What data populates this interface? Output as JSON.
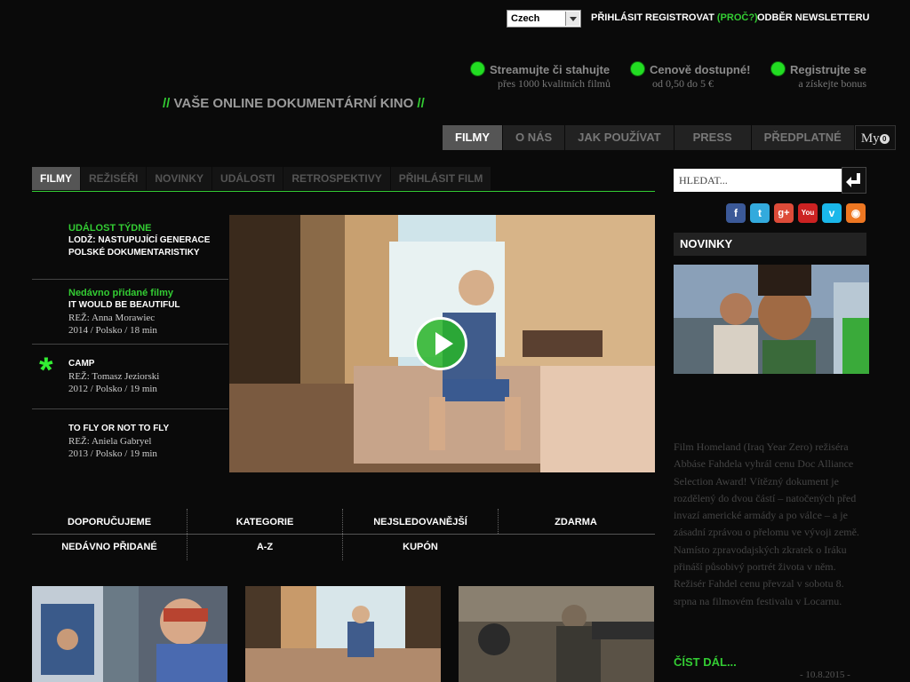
{
  "topbar": {
    "language": "Czech",
    "login": "PŘIHLÁSIT",
    "register": "REGISTROVAT",
    "register_why": "(PROČ?)",
    "newsletter": "ODBĚR NEWSLETTERU"
  },
  "features": [
    {
      "title": "Streamujte či stahujte",
      "sub": "přes 1000 kvalitních filmů"
    },
    {
      "title": "Cenově dostupné!",
      "sub": "od 0,50 do 5 €"
    },
    {
      "title": "Registrujte se",
      "sub": "a získejte bonus"
    }
  ],
  "tagline": {
    "slash_left": "//",
    "text": "VAŠE ONLINE DOKUMENTÁRNÍ KINO",
    "slash_right": "//"
  },
  "main_nav": [
    {
      "label": "FILMY",
      "active": true
    },
    {
      "label": "O NÁS"
    },
    {
      "label": "JAK POUŽÍVAT"
    },
    {
      "label": "PRESS"
    },
    {
      "label": "PŘEDPLATNÉ"
    },
    {
      "label": "My"
    }
  ],
  "my_badge": "0",
  "sub_nav": [
    {
      "label": "FILMY",
      "active": true
    },
    {
      "label": "REŽISÉŘI"
    },
    {
      "label": "NOVINKY"
    },
    {
      "label": "UDÁLOSTI"
    },
    {
      "label": "RETROSPEKTIVY"
    },
    {
      "label": "PŘIHLÁSIT FILM"
    }
  ],
  "left_list": {
    "event": {
      "category": "UDÁLOST TÝDNE",
      "title_line1": "LODŽ: NASTUPUJÍCÍ GENERACE",
      "title_line2": "POLSKÉ DOKUMENTARISTIKY"
    },
    "film1": {
      "category": "Nedávno přidané filmy",
      "title": "IT WOULD BE BEAUTIFUL",
      "director": "REŽ: Anna Morawiec",
      "meta": "2014 / Polsko / 18 min"
    },
    "film2": {
      "title": "CAMP",
      "director": "REŽ: Tomasz Jeziorski",
      "meta": "2012 / Polsko / 19 min"
    },
    "film3": {
      "title": "TO FLY OR NOT TO FLY",
      "director": "REŽ: Aniela Gabryel",
      "meta": "2013 / Polsko / 19 min"
    },
    "star": "*"
  },
  "categories": {
    "row1": [
      "DOPORUČUJEME",
      "KATEGORIE",
      "NEJSLEDOVANĚJŠÍ",
      "ZDARMA"
    ],
    "row2": [
      "NEDÁVNO PŘIDANÉ",
      "A-Z",
      "KUPÓN"
    ]
  },
  "search": {
    "placeholder": "HLEDAT..."
  },
  "social": [
    {
      "icon": "facebook-icon",
      "glyph": "f",
      "color": "#3b5998"
    },
    {
      "icon": "twitter-icon",
      "glyph": "t",
      "color": "#33aadd"
    },
    {
      "icon": "googleplus-icon",
      "glyph": "g+",
      "color": "#dd4b39"
    },
    {
      "icon": "youtube-icon",
      "glyph": "You",
      "color": "#cc2222"
    },
    {
      "icon": "vimeo-icon",
      "glyph": "v",
      "color": "#1ab7ea"
    },
    {
      "icon": "rss-icon",
      "glyph": "◉",
      "color": "#ee7722"
    }
  ],
  "news": {
    "heading": "NOVINKY",
    "text": "Film Homeland (Iraq Year Zero) režiséra Abbáse Fahdela vyhrál cenu Doc Alliance Selection Award! Vítězný dokument je rozdělený do dvou částí – natočených před invazí americké armády a po válce – a je zásadní zprávou o přelomu ve vývoji země. Namísto zpravodajských zkratek o Iráku přináší působivý portrét života v něm. Režisér Fahdel cenu převzal v sobotu 8. srpna na filmovém festivalu v Locarnu.",
    "read_more": "ČÍST DÁL...",
    "date": "- 10.8.2015 -"
  },
  "colors": {
    "accent": "#33cc33",
    "background": "#0a0a0a"
  }
}
